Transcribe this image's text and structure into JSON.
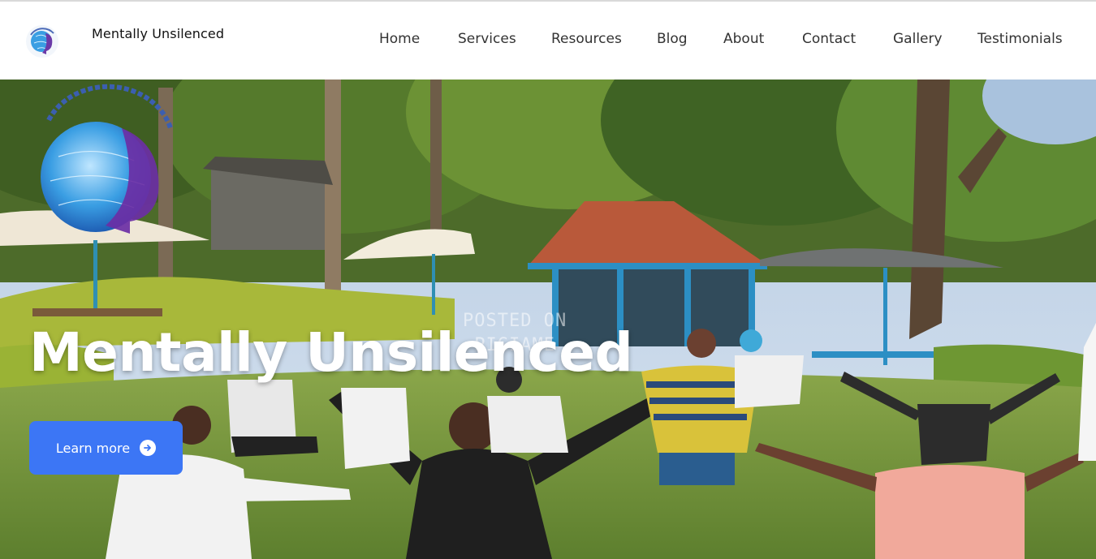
{
  "header": {
    "brand": "Mentally Unsilenced",
    "logo_icon": "globe-head-logo-icon",
    "nav": [
      {
        "label": "Home"
      },
      {
        "label": "Services"
      },
      {
        "label": "Resources"
      },
      {
        "label": "Blog"
      },
      {
        "label": "About"
      },
      {
        "label": "Contact"
      },
      {
        "label": "Gallery"
      },
      {
        "label": "Testimonials"
      }
    ]
  },
  "hero": {
    "title": "Mentally Unsilenced",
    "cta_label": "Learn more",
    "cta_icon": "arrow-right-circle-icon",
    "watermark_line1": "POSTED ON",
    "watermark_line2": "PIGIAME",
    "colors": {
      "cta_background": "#3c76f5",
      "title": "#ffffff"
    }
  }
}
